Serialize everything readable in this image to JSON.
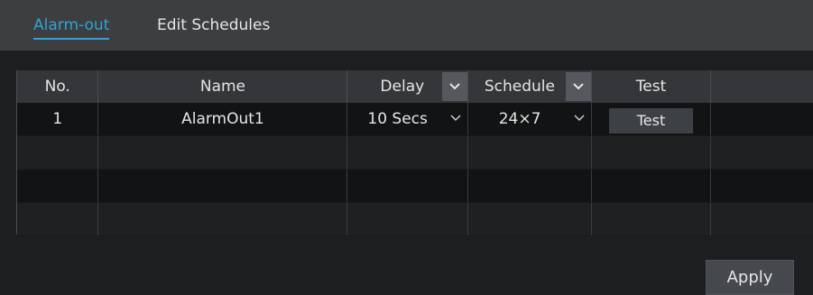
{
  "tabs": [
    {
      "label": "Alarm-out",
      "active": true
    },
    {
      "label": "Edit Schedules",
      "active": false
    }
  ],
  "table": {
    "columns": {
      "no": "No.",
      "name": "Name",
      "delay": "Delay",
      "schedule": "Schedule",
      "test": "Test",
      "extra": ""
    },
    "rows": [
      {
        "no": "1",
        "name": "AlarmOut1",
        "delay": "10 Secs",
        "schedule": "24×7",
        "test_label": "Test"
      },
      {
        "no": "",
        "name": "",
        "delay": "",
        "schedule": "",
        "test_label": ""
      },
      {
        "no": "",
        "name": "",
        "delay": "",
        "schedule": "",
        "test_label": ""
      },
      {
        "no": "",
        "name": "",
        "delay": "",
        "schedule": "",
        "test_label": ""
      }
    ]
  },
  "footer": {
    "apply_label": "Apply"
  },
  "icons": {
    "dropdown": "chevron-down-icon"
  },
  "colors": {
    "accent": "#2fa4d6",
    "background": "#1d1e20",
    "tabbar": "#3c3e40"
  }
}
